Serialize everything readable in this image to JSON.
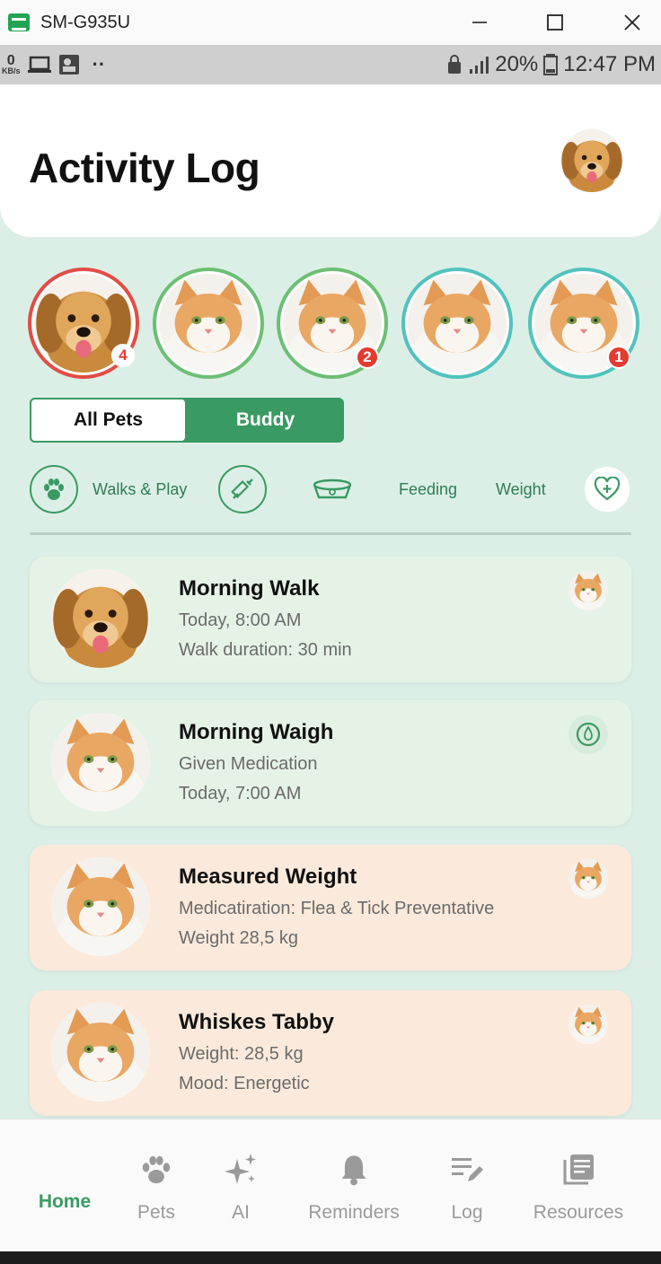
{
  "window": {
    "title": "SM-G935U"
  },
  "statusbar": {
    "kb": "0",
    "kb_unit": "KB/s",
    "dots": "··",
    "battery": "20%",
    "time": "12:47 PM"
  },
  "header": {
    "title": "Activity Log"
  },
  "pets": [
    {
      "ring": "red",
      "badge": "4",
      "kind": "dog"
    },
    {
      "ring": "green",
      "badge": "",
      "kind": "cat"
    },
    {
      "ring": "green",
      "badge": "2",
      "kind": "cat"
    },
    {
      "ring": "teal",
      "badge": "",
      "kind": "cat"
    },
    {
      "ring": "teal",
      "badge": "1",
      "kind": "cat"
    }
  ],
  "segment": {
    "all": "All Pets",
    "buddy": "Buddy"
  },
  "filters": {
    "walks": "Walks & Play",
    "feeding": "Feeding",
    "weight": "Weight"
  },
  "cards": [
    {
      "title": "Morning Walk",
      "line1": "Today, 8:00 AM",
      "line2": "Walk duration: 30 min"
    },
    {
      "title": "Morning Waigh",
      "line1": "Given Medication",
      "line2": "Today, 7:00 AM"
    },
    {
      "title": "Measured Weight",
      "line1": "Medicatiration: Flea & Tick Preventative",
      "line2": "Weight 28,5 kg"
    },
    {
      "title": "Whiskes Tabby",
      "line1": "Weight: 28,5 kg",
      "line2": "Mood: Energetic"
    }
  ],
  "nav": {
    "home": "Home",
    "pets": "Pets",
    "ai": "AI",
    "reminders": "Reminders",
    "log": "Log",
    "resources": "Resources"
  },
  "colors": {
    "accent": "#3a9a63",
    "bg": "#dcefe6",
    "red": "#e24d45",
    "teal": "#52c2bd"
  }
}
